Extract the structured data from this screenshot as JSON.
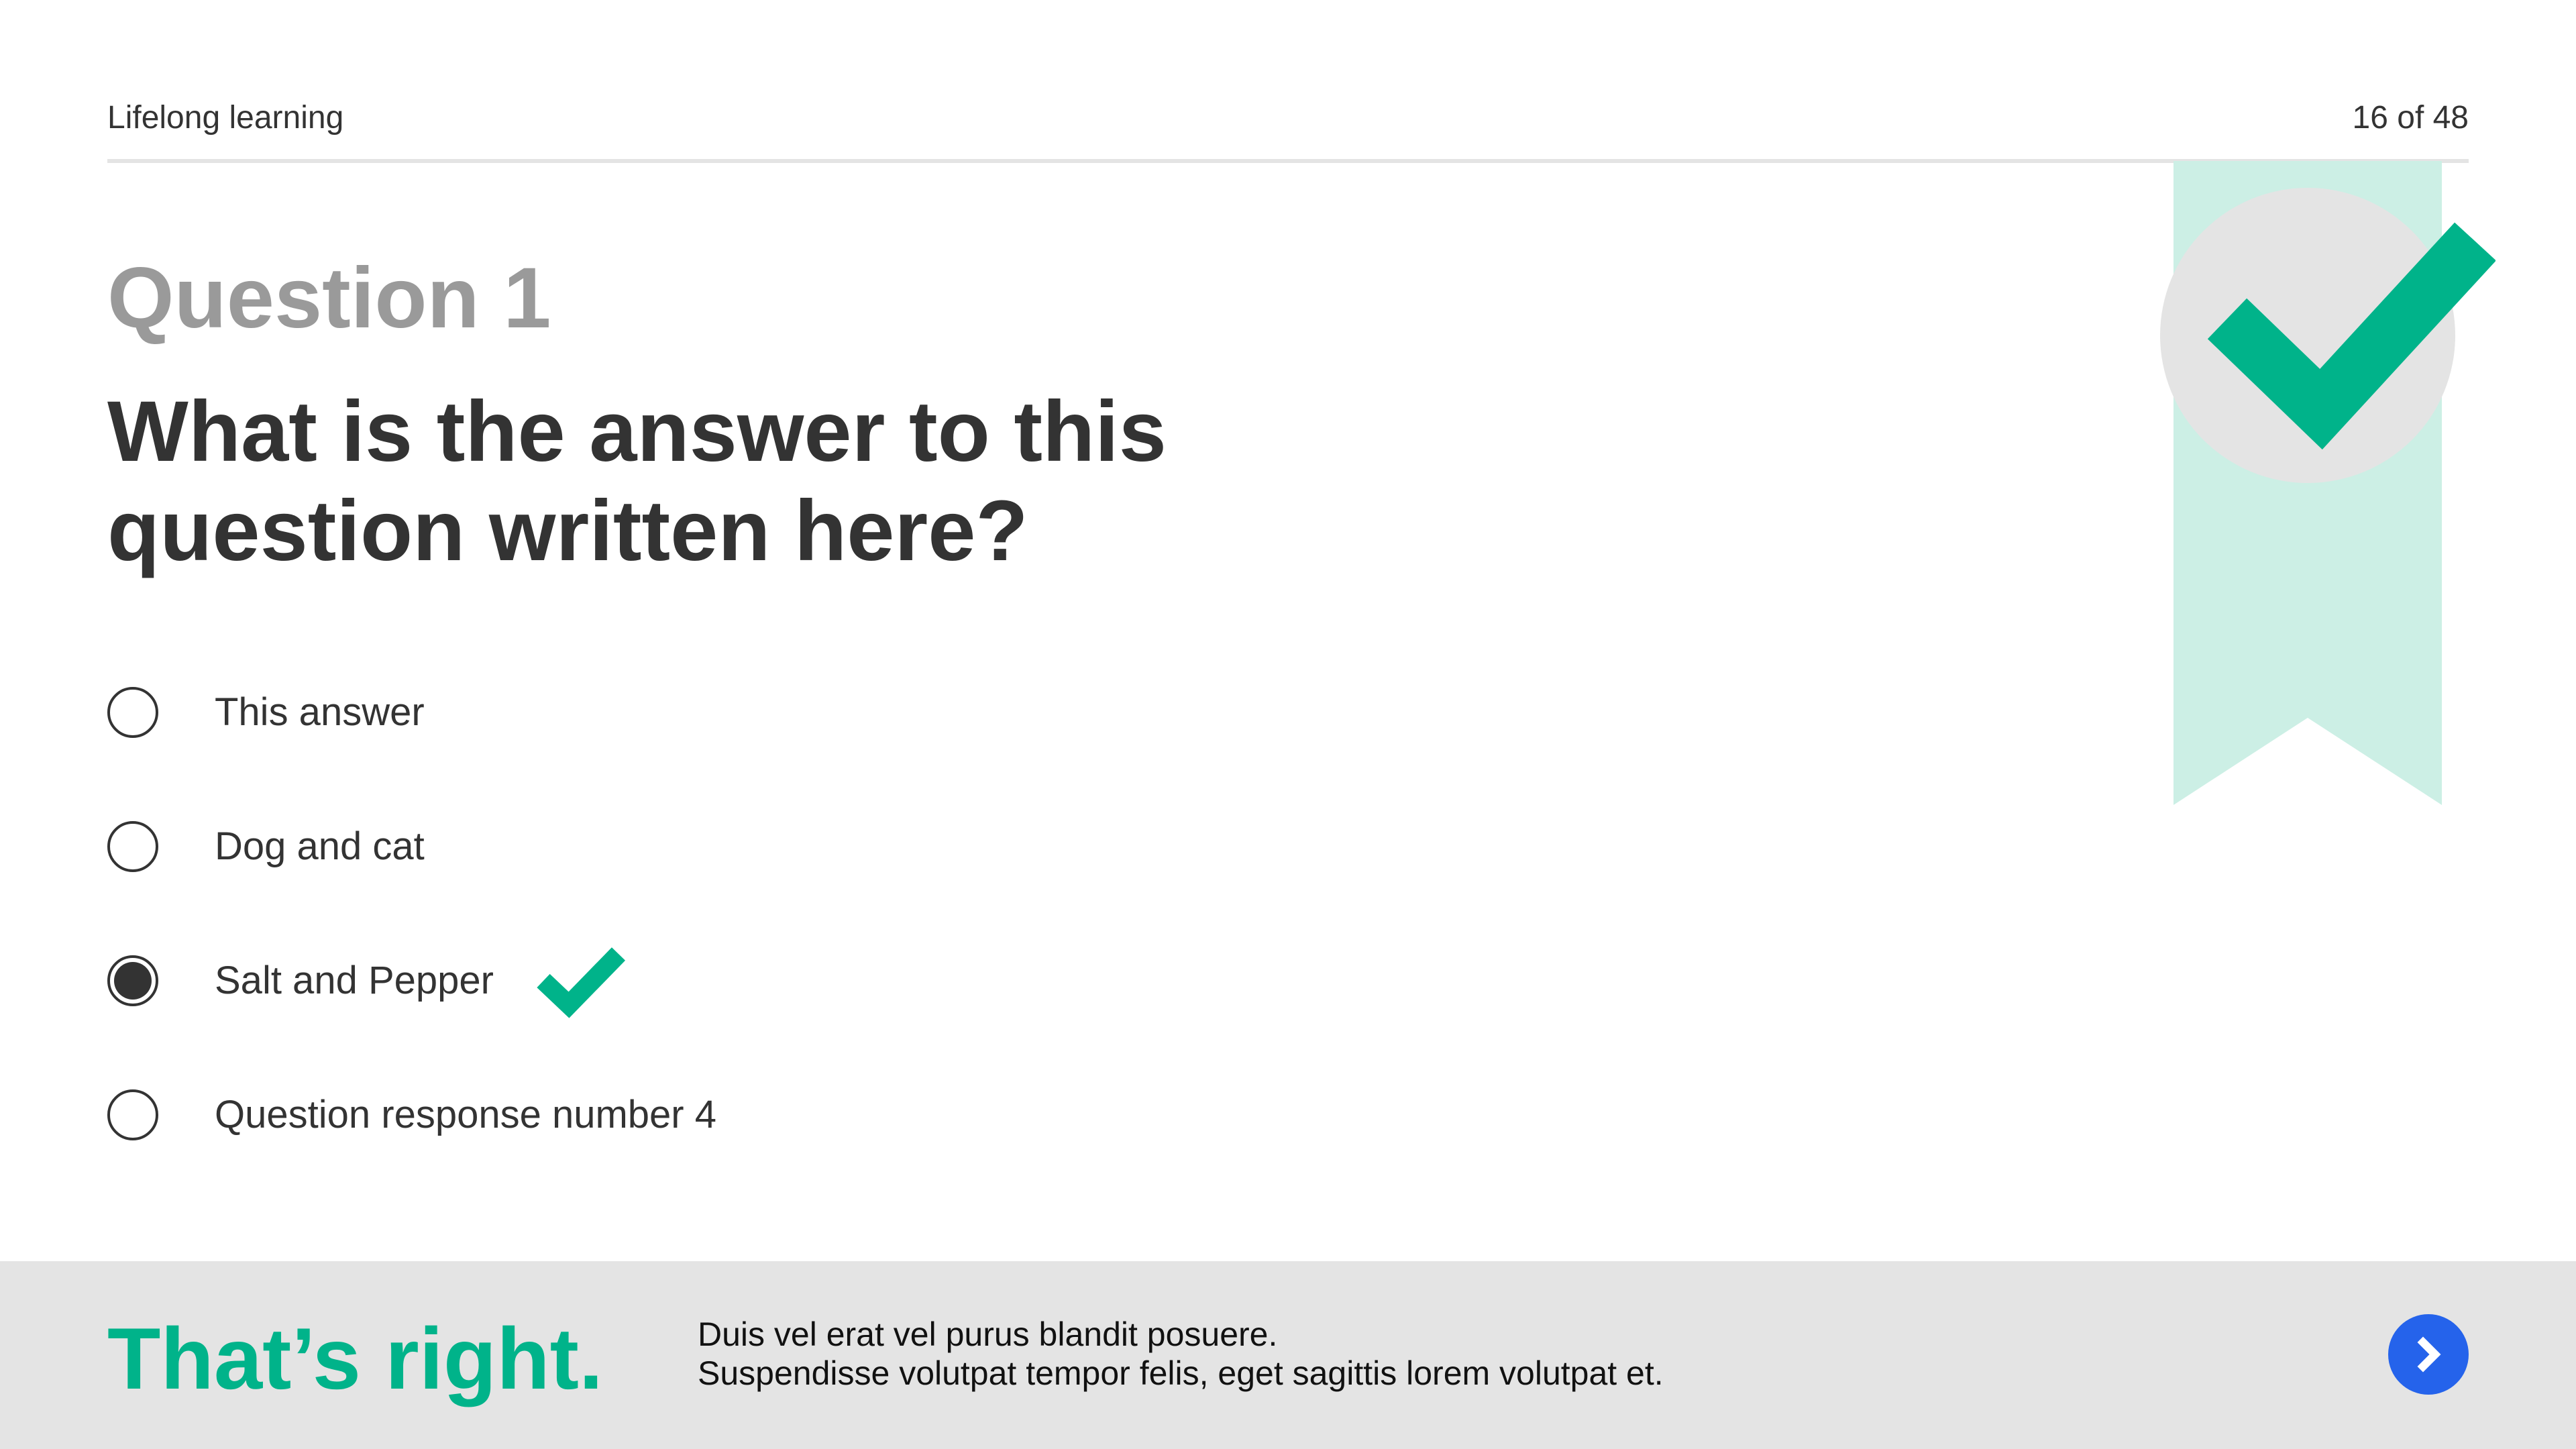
{
  "header": {
    "title": "Lifelong learning",
    "progress": "16 of 48"
  },
  "badge": {
    "icon": "check-icon",
    "ribbon_color": "#ccefe5",
    "circle_color": "#e4e4e4",
    "check_color": "#00b38a"
  },
  "question": {
    "number": "Question 1",
    "text": "What is the answer to this question written here?"
  },
  "options": [
    {
      "label": "This answer",
      "selected": false
    },
    {
      "label": "Dog and cat",
      "selected": false
    },
    {
      "label": "Salt and Pepper",
      "selected": true,
      "marked_correct": true
    },
    {
      "label": "Question response number 4",
      "selected": false
    }
  ],
  "feedback": {
    "title": "That’s right.",
    "line1": "Duis vel erat vel purus blandit posuere.",
    "line2": "Suspendisse volutpat tempor felis, eget sagittis lorem volutpat et."
  },
  "next_button": {
    "icon": "chevron-right-icon",
    "color": "#2563eb"
  },
  "colors": {
    "accent": "#00b38a",
    "text": "#333333",
    "muted": "#9a9a9a",
    "footer_bg": "#e4e4e4"
  }
}
